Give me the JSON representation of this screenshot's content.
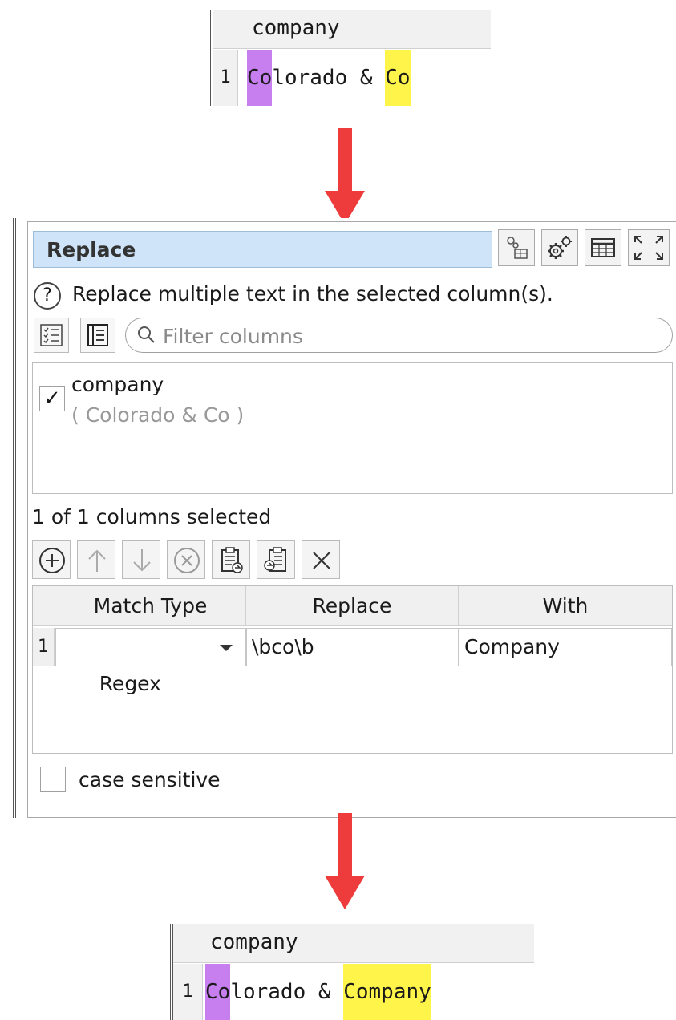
{
  "before_table": {
    "header": "company",
    "row_number": "1",
    "cell": {
      "match1": "Co",
      "middle": "lorado & ",
      "match2": "Co"
    }
  },
  "panel": {
    "title": "Replace",
    "description": "Replace multiple text in the selected column(s).",
    "help_glyph": "?",
    "filter_placeholder": "Filter columns",
    "columns": [
      {
        "name": "company",
        "preview": "( Colorado & Co )",
        "checked": true
      }
    ],
    "selected_count": "1 of 1 columns selected",
    "grid": {
      "headers": [
        "Match Type",
        "Replace",
        "With"
      ],
      "rows": [
        {
          "num": "1",
          "match_type": "Regex",
          "replace": "\\bco\\b",
          "with": "Company"
        }
      ]
    },
    "case_sensitive_label": "case sensitive",
    "case_sensitive_checked": false
  },
  "after_table": {
    "header": "company",
    "row_number": "1",
    "cell": {
      "match1": "Co",
      "middle": "lorado & ",
      "match2": "Company"
    }
  },
  "colors": {
    "arrow": "#ee3b3b",
    "title_bg": "#cfe4f8",
    "highlight_purple": "#c77ff0",
    "highlight_yellow": "#fff54a"
  },
  "icons": {
    "toolbar": [
      "column-link-icon",
      "settings-icon",
      "table-icon",
      "fullscreen-icon"
    ],
    "column_list": [
      "checklist-icon",
      "list-icon",
      "search-icon"
    ],
    "rows": [
      "add-icon",
      "move-up-icon",
      "move-down-icon",
      "remove-icon",
      "paste-icon",
      "copy-icon",
      "clear-icon"
    ]
  }
}
